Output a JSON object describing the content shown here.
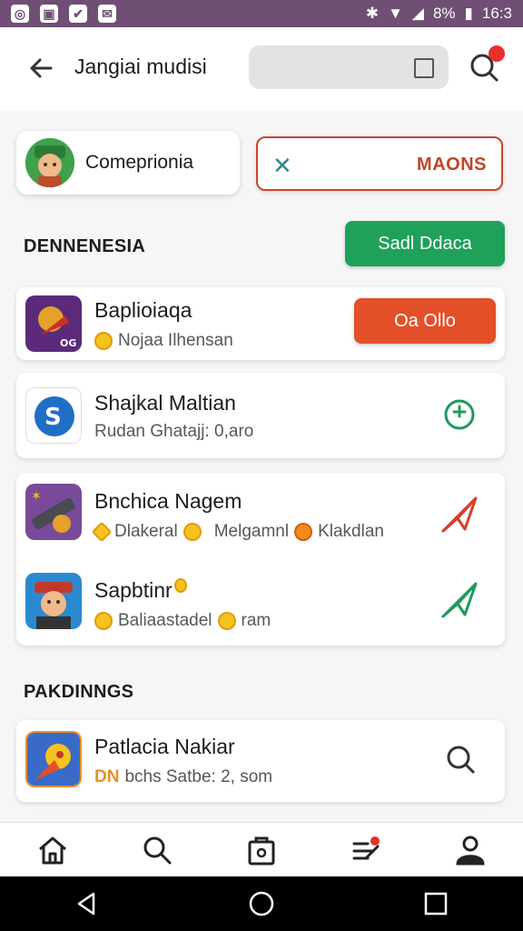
{
  "status_bar": {
    "left_icons": [
      "camera-icon",
      "image-icon",
      "check-icon",
      "mail-icon"
    ],
    "battery_text": "8%",
    "time": "16:3"
  },
  "header": {
    "title": "Jangiai mudisi"
  },
  "filters": {
    "category_label": "Comeprionia",
    "clear_label": "MAONS"
  },
  "section1": {
    "title": "DENNENESIA",
    "action_label": "Sadl Ddaca"
  },
  "apps_group1": [
    {
      "name": "Baplioiaqa",
      "sub": "Nojaa Ilhensan",
      "action_label": "Oa Ollo"
    },
    {
      "name": "Shajkal Maltian",
      "sub": "Rudan   Ghatajj: 0,aro"
    }
  ],
  "apps_group2": [
    {
      "name": "Bnchica Nagem",
      "sub_a": "Dlakeral",
      "sub_b": "Melgamnl",
      "sub_c": "Klakdlan"
    },
    {
      "name": "Sapbtinr",
      "sub": "Baliaastadel",
      "sub_end": "ram"
    }
  ],
  "section2": {
    "title": "PAKDINNGS"
  },
  "apps_group3": [
    {
      "name": "Patlacia Nakiar",
      "sub_prefix": "DN",
      "sub": "bchs  Satbe: 2, som"
    }
  ],
  "colors": {
    "status_bar": "#6f4f74",
    "accent_green": "#1fa15a",
    "accent_red": "#e3502a",
    "outline_red": "#c9462f",
    "teal": "#2f8a86"
  }
}
